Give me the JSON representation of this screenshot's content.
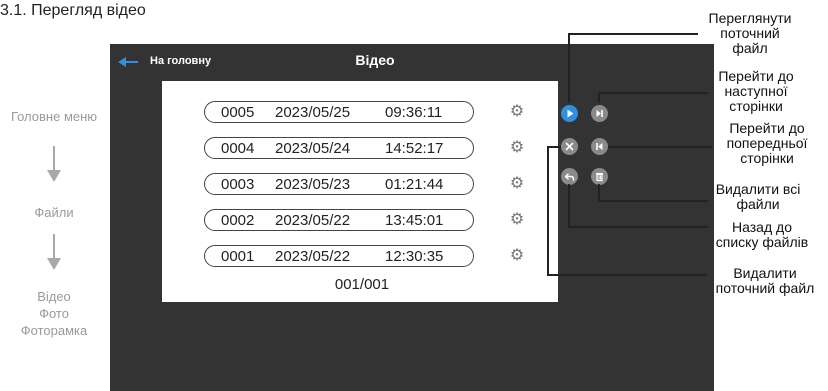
{
  "section_title": "3.1. Перегляд відео",
  "flow": {
    "step1": "Головне меню",
    "step2": "Файли",
    "step3_lines": [
      "Відео",
      "Фото",
      "Фоторамка"
    ]
  },
  "screen": {
    "home_label": "На головну",
    "title": "Відео",
    "files": [
      {
        "num": "0005",
        "date": "2023/05/25",
        "time": "09:36:11"
      },
      {
        "num": "0004",
        "date": "2023/05/24",
        "time": "14:52:17"
      },
      {
        "num": "0003",
        "date": "2023/05/23",
        "time": "01:21:44"
      },
      {
        "num": "0002",
        "date": "2023/05/22",
        "time": "13:45:01"
      },
      {
        "num": "0001",
        "date": "2023/05/22",
        "time": "12:30:35"
      }
    ],
    "page": "001/001"
  },
  "icons": {
    "back": "arrow-left-icon",
    "settings": "gear-icon",
    "play": "play-icon",
    "next_page": "skip-next-icon",
    "prev_page": "skip-previous-icon",
    "delete_current": "close-icon",
    "back_to_list": "undo-icon",
    "delete_all": "trash-icon"
  },
  "colors": {
    "screen_bg": "#333333",
    "accent_blue": "#2f8fe0",
    "control_gray": "#8a8a8a"
  },
  "callouts": {
    "view_current": [
      "Переглянути",
      "поточний",
      "файл"
    ],
    "next_page": [
      "Перейти до",
      "наступної",
      "сторінки"
    ],
    "prev_page": [
      "Перейти до",
      "попередньої",
      "сторінки"
    ],
    "delete_all": [
      "Видалити всі",
      "файли"
    ],
    "back_to_list": [
      "Назад до",
      "списку файлів"
    ],
    "delete_current": [
      "Видалити",
      "поточний файл"
    ]
  }
}
